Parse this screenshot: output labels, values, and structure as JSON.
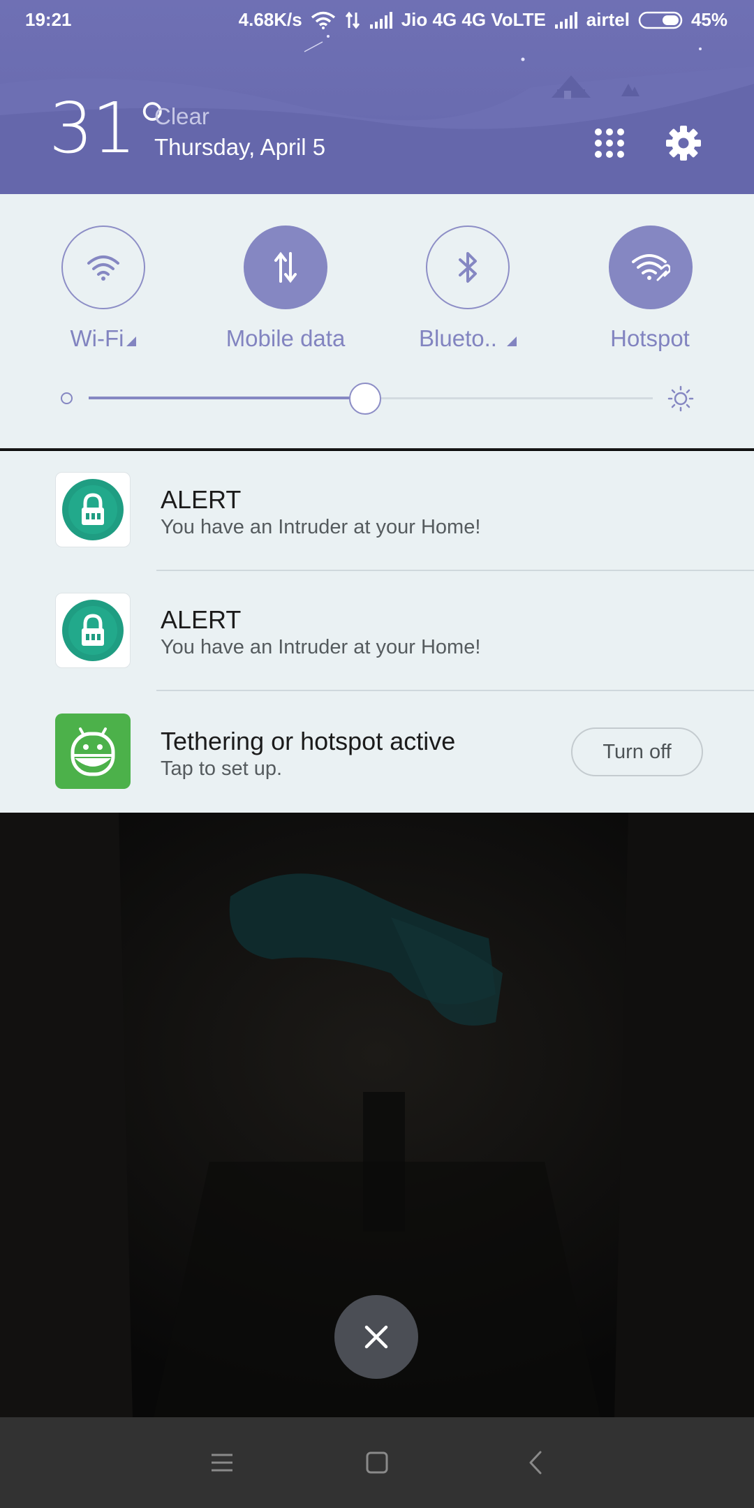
{
  "status_bar": {
    "time": "19:21",
    "net_speed": "4.68K/s",
    "carrier1": "Jio 4G 4G VoLTE",
    "carrier2": "airtel",
    "battery": "45%",
    "battery_level": 0.45
  },
  "weather": {
    "temperature": "31°",
    "condition": "Clear",
    "date": "Thursday, April 5"
  },
  "header_buttons": {
    "apps_icon": "grid-icon",
    "settings_icon": "gear-icon"
  },
  "quick_settings": {
    "toggles": [
      {
        "label": "Wi-Fi",
        "icon": "wifi-icon",
        "active": false,
        "has_expand": true
      },
      {
        "label": "Mobile data",
        "icon": "mobile-data-icon",
        "active": true,
        "has_expand": false
      },
      {
        "label": "Blueto..",
        "icon": "bluetooth-icon",
        "active": false,
        "has_expand": true
      },
      {
        "label": "Hotspot",
        "icon": "hotspot-icon",
        "active": true,
        "has_expand": false
      }
    ],
    "brightness_level": 0.49
  },
  "notifications": [
    {
      "title": "ALERT",
      "body": "You have an Intruder at your Home!",
      "icon": "lock-app-icon"
    },
    {
      "title": "ALERT",
      "body": "You have an Intruder at your Home!",
      "icon": "lock-app-icon"
    },
    {
      "title": "Tethering or hotspot active",
      "body": "Tap to set up.",
      "icon": "android-icon",
      "action": "Turn off"
    }
  ],
  "colors": {
    "accent": "#8587c2",
    "header": "#6a6cb0",
    "panel": "#eaf1f3",
    "lock_green": "#1fa387",
    "android_green": "#4cb14a"
  }
}
